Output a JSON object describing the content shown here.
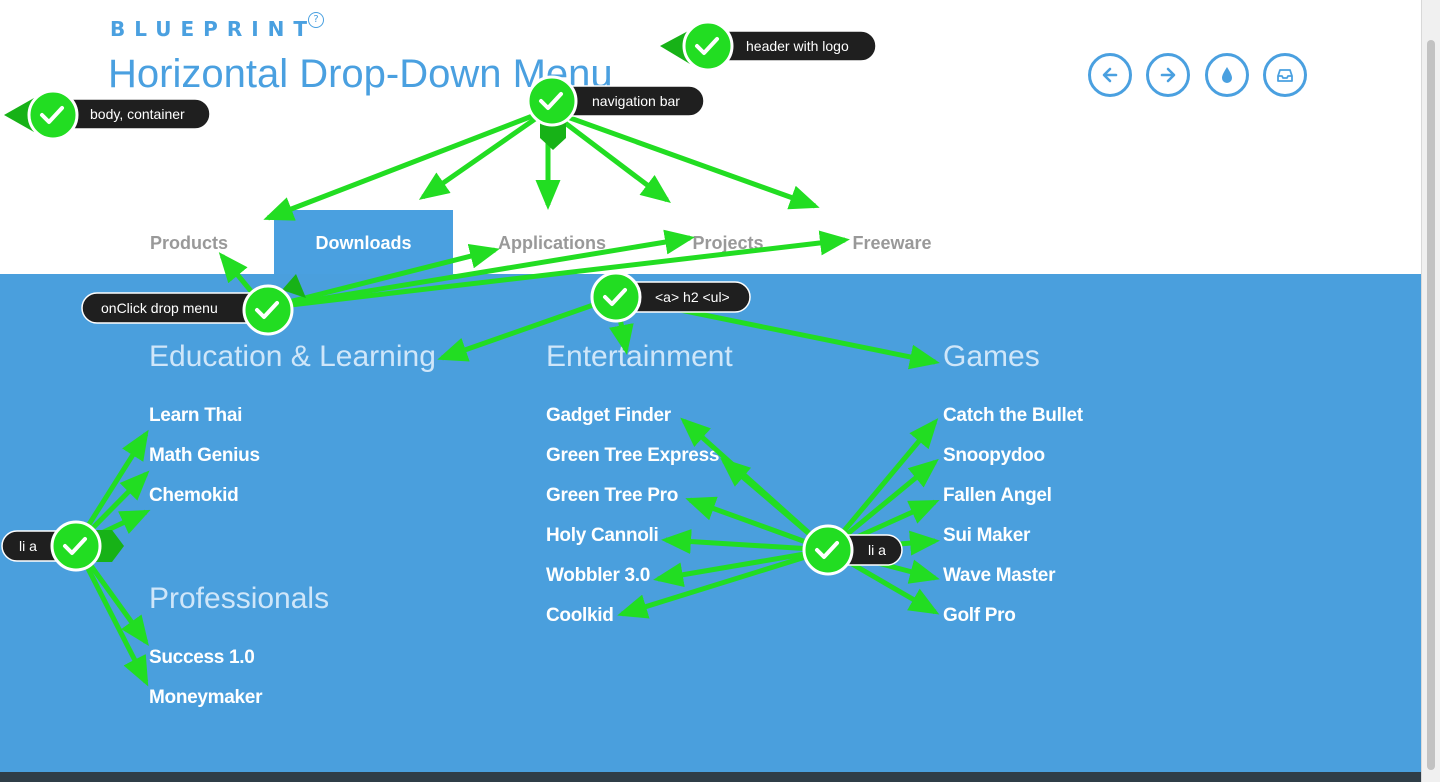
{
  "header": {
    "logo": "BLUEPRINT",
    "logo_mark": "?",
    "title": "Horizontal Drop-Down Menu",
    "buttons": [
      {
        "name": "previous-button",
        "icon": "arrow-left-icon"
      },
      {
        "name": "next-button",
        "icon": "arrow-right-icon"
      },
      {
        "name": "theme-button",
        "icon": "water-drop-icon"
      },
      {
        "name": "inbox-button",
        "icon": "inbox-tray-icon"
      }
    ]
  },
  "nav": {
    "items": [
      {
        "label": "Products",
        "active": false
      },
      {
        "label": "Downloads",
        "active": true
      },
      {
        "label": "Applications",
        "active": false
      },
      {
        "label": "Projects",
        "active": false
      },
      {
        "label": "Freeware",
        "active": false
      }
    ]
  },
  "dropdown": {
    "columns": [
      {
        "groups": [
          {
            "heading": "Education & Learning",
            "links": [
              "Learn Thai",
              "Math Genius",
              "Chemokid"
            ]
          },
          {
            "heading": "Professionals",
            "links": [
              "Success 1.0",
              "Moneymaker"
            ]
          }
        ]
      },
      {
        "groups": [
          {
            "heading": "Entertainment",
            "links": [
              "Gadget Finder",
              "Green Tree Express",
              "Green Tree Pro",
              "Holy Cannoli",
              "Wobbler 3.0",
              "Coolkid"
            ]
          }
        ]
      },
      {
        "groups": [
          {
            "heading": "Games",
            "links": [
              "Catch the Bullet",
              "Snoopydoo",
              "Fallen Angel",
              "Sui Maker",
              "Wave Master",
              "Golf Pro"
            ]
          }
        ]
      }
    ]
  },
  "annotations": {
    "header_with_logo": "header with logo",
    "navigation_bar": "navigation bar",
    "body_container": "body, container",
    "onclick_drop_menu": "onClick drop menu",
    "a_h2_ul": "<a> h2 <ul>",
    "li_a_left": "li a",
    "li_a_right": "li a"
  },
  "colors": {
    "accent": "#4aa0e0",
    "dropdown_bg": "#4a9fdd",
    "nav_inactive": "#999999",
    "annotation_green": "#22dd22",
    "annotation_tag_bg": "#1f1f1f"
  }
}
